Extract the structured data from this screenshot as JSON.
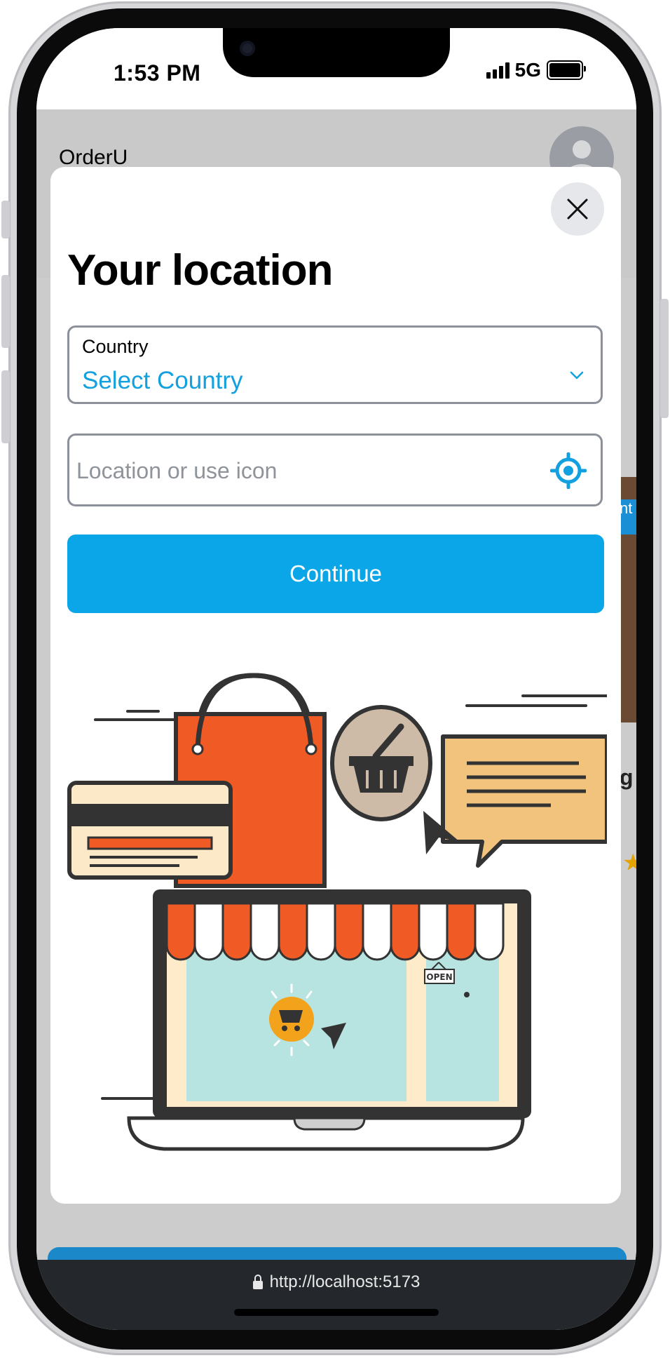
{
  "status_bar": {
    "time": "1:53 PM",
    "network": "5G"
  },
  "app": {
    "title": "OrderU"
  },
  "modal": {
    "title": "Your location",
    "country_field": {
      "label": "Country",
      "value": "Select Country"
    },
    "location_field": {
      "placeholder": "Location or use icon"
    },
    "continue_label": "Continue",
    "illustration": {
      "shop_sign": "OPEN"
    }
  },
  "background_peek": {
    "badge_text": "nt",
    "card_text": "g"
  },
  "browser": {
    "url": "http://localhost:5173"
  },
  "colors": {
    "accent": "#0ba6e8",
    "link_text": "#12a0de",
    "overlay_gray": "#cccccc",
    "browser_bar": "#24282c"
  },
  "icons": [
    "close-icon",
    "chevron-down-icon",
    "locate-icon",
    "lock-icon",
    "avatar-icon",
    "star-icon"
  ]
}
